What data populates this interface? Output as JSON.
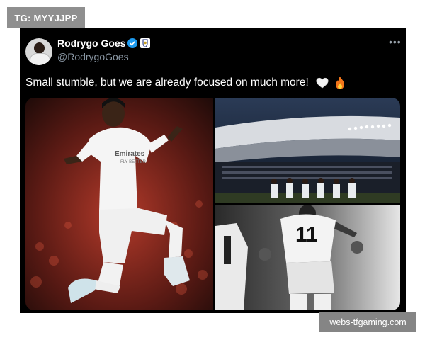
{
  "watermark_top": "TG: MYYJJPP",
  "watermark_bottom": "webs-tfgaming.com",
  "tweet": {
    "author_name": "Rodrygo Goes",
    "author_handle": "@RodrygoGoes",
    "verified_icon": "verified-badge-icon",
    "affiliate_icon": "real-madrid-crest-icon",
    "more_icon": "more-options-icon",
    "text": "Small stumble, but we are already focused on much more!",
    "emojis": [
      "white-heart-emoji",
      "fire-emoji"
    ],
    "jersey_sponsor": "Emirates",
    "jersey_sponsor_sub": "FLY BETTER",
    "jersey_number": "11"
  },
  "colors": {
    "tweet_bg": "#000000",
    "text": "#ffffff",
    "handle": "#8b98a5",
    "verified": "#1d9bf0",
    "watermark_bg": "#8f8f8f"
  }
}
